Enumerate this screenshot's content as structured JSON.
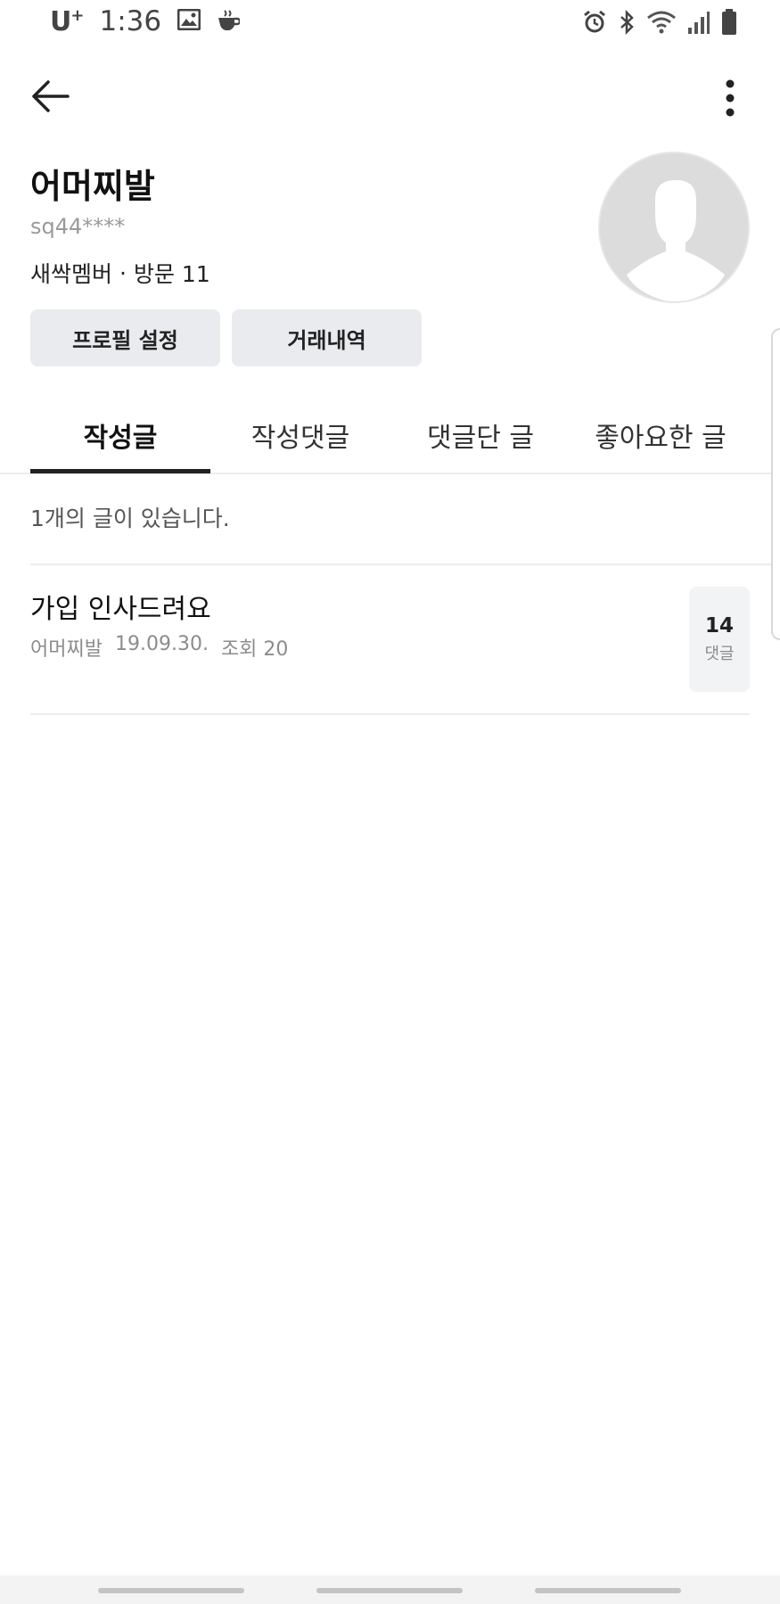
{
  "status_bar": {
    "carrier": "U",
    "carrier_sup": "+",
    "time": "1:36"
  },
  "profile": {
    "name": "어머찌발",
    "user_id": "sq44****",
    "level": "새싹멤버",
    "separator": "·",
    "visits": "방문 11"
  },
  "buttons": {
    "profile_settings": "프로필 설정",
    "trade_history": "거래내역"
  },
  "tabs": [
    {
      "label": "작성글",
      "active": true
    },
    {
      "label": "작성댓글",
      "active": false
    },
    {
      "label": "댓글단 글",
      "active": false
    },
    {
      "label": "좋아요한 글",
      "active": false
    }
  ],
  "post_count_text": "1개의 글이 있습니다.",
  "posts": [
    {
      "title": "가입 인사드려요",
      "author": "어머찌발",
      "date": "19.09.30.",
      "views": "조회 20",
      "comment_count": "14",
      "comment_label": "댓글"
    }
  ],
  "colors": {
    "accent": "#222222",
    "button_bg": "#e9ebee",
    "muted_text": "#8c8c8c"
  }
}
